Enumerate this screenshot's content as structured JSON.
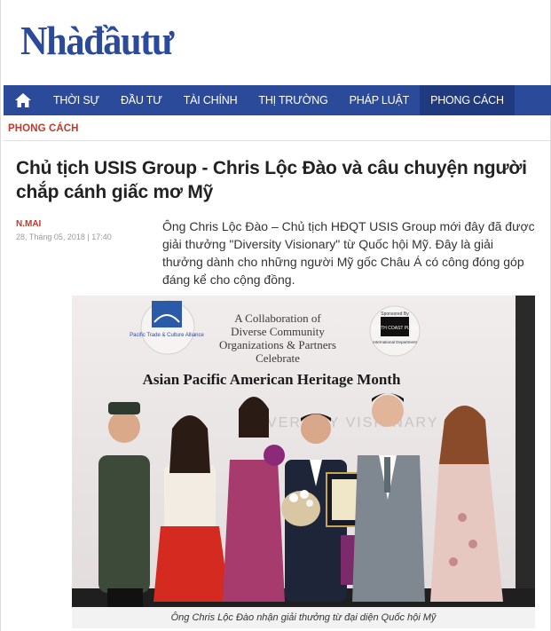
{
  "site": {
    "logo": "Nhàđầutư"
  },
  "nav": {
    "items": [
      {
        "label": "THỜI SỰ"
      },
      {
        "label": "ĐẦU TƯ"
      },
      {
        "label": "TÀI CHÍNH"
      },
      {
        "label": "THỊ TRƯỜNG"
      },
      {
        "label": "PHÁP LUẬT"
      },
      {
        "label": "PHONG CÁCH"
      }
    ]
  },
  "section": {
    "label": "PHONG CÁCH"
  },
  "article": {
    "title": "Chủ tịch USIS Group - Chris Lộc Đào và câu chuyện người chắp cánh giấc mơ Mỹ",
    "author": "N.MAI",
    "date": "28, Tháng 05, 2018 | 17:40",
    "sapo": "Ông Chris Lộc Đào – Chủ tịch HĐQT USIS Group mới đây đã được giải thưởng \"Diversity Visionary\" từ Quốc hội Mỹ. Đây là giải thưởng dành cho những người Mỹ gốc Châu Á có công đóng góp đáng kể cho cộng đồng."
  },
  "photo": {
    "backdrop": {
      "line1": "A Collaboration of",
      "line2": "Diverse Community",
      "line3": "Organizations & Partners",
      "line4": "Celebrate",
      "heading": "Asian Pacific American Heritage Month",
      "left_seal": "Pacific Trade & Culture Alliance",
      "right_seal_top": "Sponsored By",
      "right_seal_name": "SOUTH COAST PLAZA",
      "right_seal_bottom": "International Department",
      "banner": "DIVERSITY VISIONARY"
    },
    "caption": "Ông Chris Lộc Đào nhận giải thưởng từ đại diện Quốc hội Mỹ"
  },
  "colors": {
    "brand": "#2b4a99",
    "nav_active": "#1f3a7e",
    "accent": "#c0392b"
  }
}
